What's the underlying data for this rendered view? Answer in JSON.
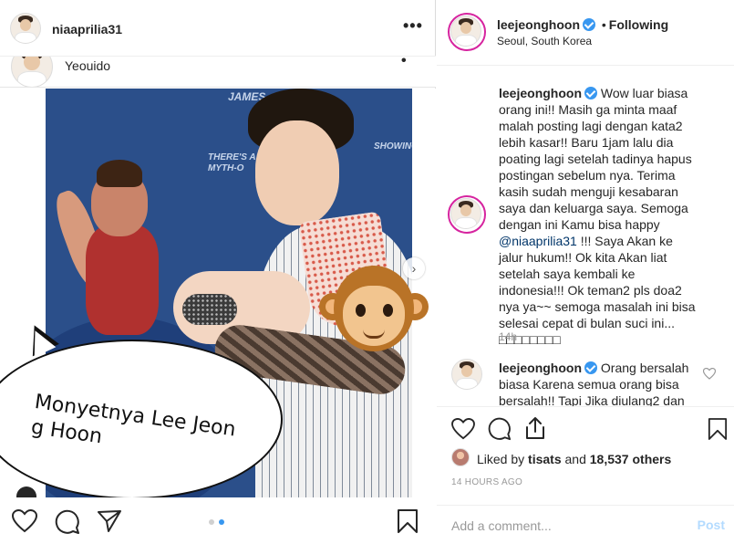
{
  "left_post": {
    "username": "niaaprilia31",
    "inner_location": "Yeouido",
    "bubble_text": "Monyetnya Lee Jeon g Hoon",
    "poster_texts": [
      "THERE'S A MYTH-O",
      "SHOWING",
      "JAMES"
    ]
  },
  "right_post": {
    "username": "leejeonghoon",
    "following_label": "Following",
    "separator": "•",
    "location": "Seoul, South Korea",
    "caption": {
      "username": "leejeonghoon",
      "text_1": "Wow luar biasa orang ini!! Masih ga minta maaf malah posting lagi dengan kata2 lebih kasar!! Baru 1jam lalu dia poating lagi setelah tadinya hapus postingan sebelum nya. Terima kasih sudah menguji kesabaran saya dan keluarga saya. Semoga dengan ini Kamu bisa happy ",
      "mention": "@niaaprilia31",
      "text_2": " !!! Saya Akan ke jalur hukum!! Ok kita Akan liat setelah saya kembali ke indonesia!!! Ok teman2 pls doa2 nya ya~~ semoga masalah ini bisa selesai cepat di bulan suci ini... □□□□□□□□",
      "time": "14h"
    },
    "reply": {
      "username": "leejeonghoon",
      "text": "Orang bersalah biasa Karena semua orang bisa bersalah!! Tapi Jika diulang2 dan"
    },
    "likes": {
      "liked_by_prefix": "Liked by",
      "liked_by_user": "tisats",
      "and_word": "and",
      "others": "18,537 others"
    },
    "post_time": "14 HOURS AGO",
    "add_comment_placeholder": "Add a comment...",
    "post_button": "Post"
  },
  "icons": {
    "left": [
      "heart-icon",
      "comment-icon",
      "share-icon",
      "bookmark-icon"
    ],
    "right": [
      "heart-icon",
      "comment-icon",
      "upload-icon",
      "bookmark-icon"
    ]
  },
  "carousel": {
    "active_index": 1,
    "count": 2
  },
  "colors": {
    "link": "#003569",
    "verified": "#3897f0",
    "post_disabled": "#b3dbff",
    "story_ring": "#d6249f",
    "active_dot": "#3897f0"
  }
}
